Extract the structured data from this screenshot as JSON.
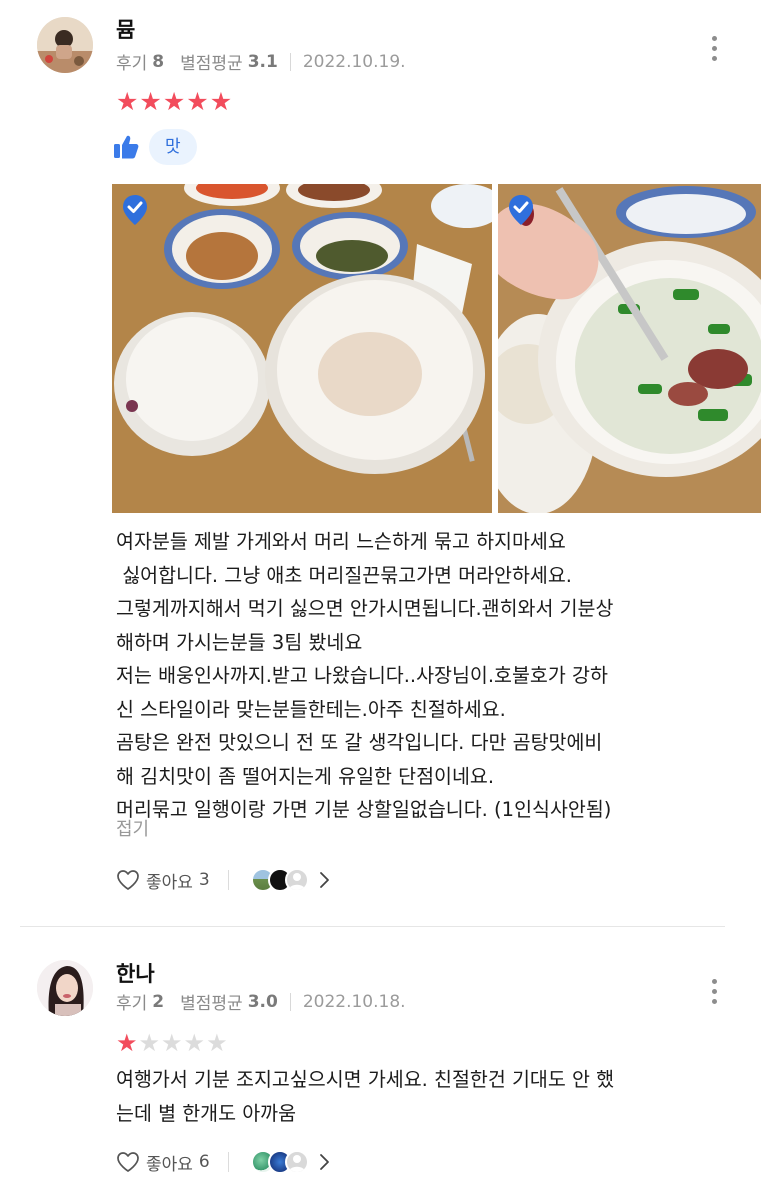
{
  "reviews": [
    {
      "name": "뮴",
      "review_label": "후기",
      "review_count": "8",
      "avg_label": "별점평균",
      "avg_value": "3.1",
      "date": "2022.10.19.",
      "rating": 5,
      "taste_tag": "맛",
      "text_lines": [
        "여자분들 제발 가게와서 머리 느슨하게 묶고 하지마세요",
        " 싫어합니다. 그냥 애초 머리질끈묶고가면 머라안하세요.",
        "그렇게까지해서 먹기 싫으면 안가시면됩니다.괜히와서 기분상",
        "해하며 가시는분들 3팀 봤네요",
        "저는 배웅인사까지.받고 나왔습니다..사장님이.호불호가 강하",
        "신 스타일이라 맞는분들한테는.아주 친절하세요.",
        "곰탕은 완전 맛있으니 전 또 갈 생각입니다. 다만 곰탕맛에비",
        "해 김치맛이 좀 떨어지는게 유일한 단점이네요.",
        "머리묶고 일행이랑 가면 기분 상할일없습니다. (1인식사안됨)"
      ],
      "fold_label": "접기",
      "like_label": "좋아요",
      "like_count": "3"
    },
    {
      "name": "한나",
      "review_label": "후기",
      "review_count": "2",
      "avg_label": "별점평균",
      "avg_value": "3.0",
      "date": "2022.10.18.",
      "rating": 1,
      "text_lines": [
        "여행가서 기분 조지고싶으시면 가세요. 친절한건 기대도 안 했",
        "는데 별 한개도 아까움"
      ],
      "like_label": "좋아요",
      "like_count": "6"
    }
  ],
  "colors": {
    "star_on": "#f24c5c",
    "star_off": "#dcdcdc",
    "accent_blue": "#2f6fdc",
    "chip_bg": "#eaf3fe"
  },
  "icons": [
    "more-vertical-icon",
    "thumbs-up-icon",
    "verified-check-icon",
    "heart-icon",
    "chevron-right-icon"
  ]
}
